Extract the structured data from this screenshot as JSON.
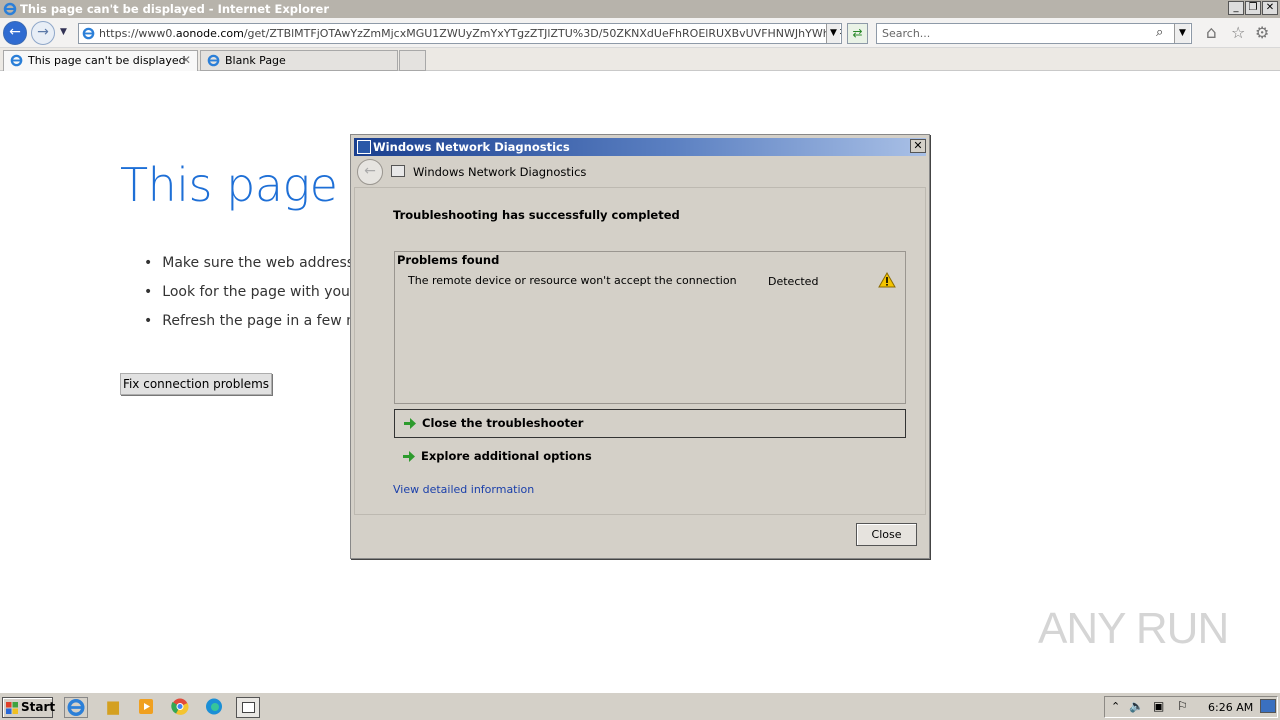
{
  "window": {
    "title": "This page can't be displayed - Internet Explorer",
    "minimize": "_",
    "restore": "❐",
    "close": "✕"
  },
  "nav": {
    "back_icon": "back-arrow-icon",
    "forward_icon": "forward-arrow-icon",
    "address_prefix": "https://www0.",
    "address_domain": "aonode.com",
    "address_rest": "/get/ZTBlMTFjOTAwYzZmMjcxMGU1ZWUyZmYxYTgzZTJlZTU%3D/50ZKNXdUeFhROElRUXBvUVFHNWJhYWhnREYzQTR3UlJF",
    "search_placeholder": "Search..."
  },
  "tabs": [
    {
      "label": "This page can't be displayed",
      "close": "✕"
    },
    {
      "label": "Blank Page"
    }
  ],
  "page": {
    "title": "This page c",
    "bullets": [
      "Make sure the web address h",
      "Look for the page with your",
      "Refresh the page in a few mi"
    ],
    "fix_button": "Fix connection problems"
  },
  "dialog": {
    "title": "Windows Network Diagnostics",
    "header_title": "Windows Network Diagnostics",
    "close_x": "✕",
    "status": "Troubleshooting has successfully completed",
    "problems_header": "Problems found",
    "problem": {
      "description": "The remote device or resource won't accept the connection",
      "status": "Detected",
      "icon": "warning-icon"
    },
    "option_close": "Close the troubleshooter",
    "option_explore": "Explore additional options",
    "detail_link": "View detailed information",
    "close_button": "Close"
  },
  "taskbar": {
    "start_label": "Start",
    "clock": "6:26 AM"
  },
  "watermark": "ANY RUN",
  "colors": {
    "ie_blue": "#1e6fd6",
    "dialog_gray": "#d4d0c8",
    "link": "#1a3faa"
  }
}
